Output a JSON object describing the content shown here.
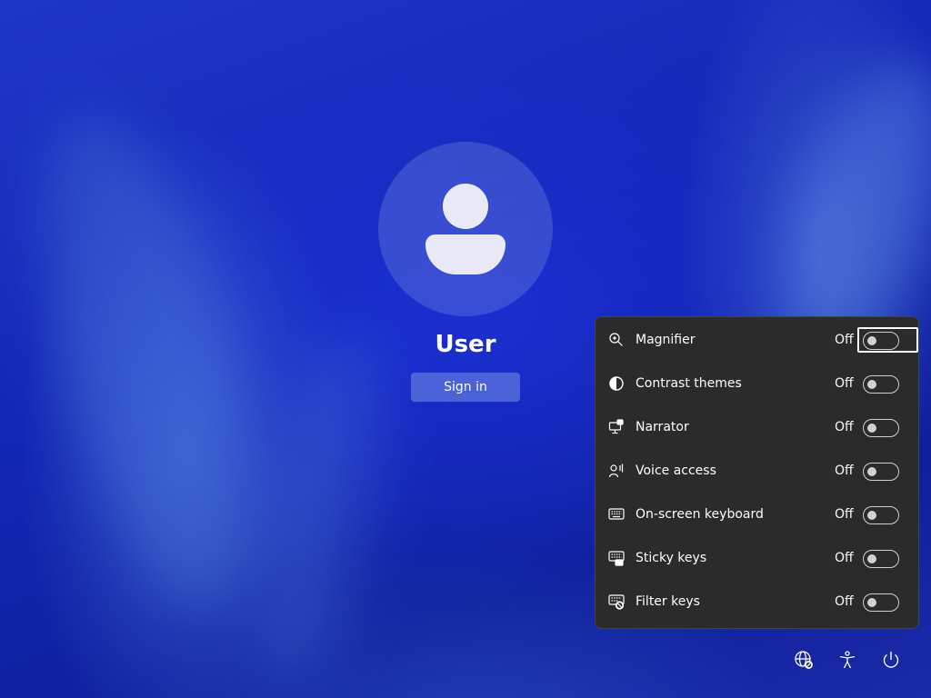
{
  "user": {
    "name": "User",
    "signin_label": "Sign in"
  },
  "accessibility_menu": {
    "items": [
      {
        "label": "Magnifier",
        "state": "Off",
        "icon": "magnifier-icon",
        "focused": true
      },
      {
        "label": "Contrast themes",
        "state": "Off",
        "icon": "contrast-icon"
      },
      {
        "label": "Narrator",
        "state": "Off",
        "icon": "narrator-icon"
      },
      {
        "label": "Voice access",
        "state": "Off",
        "icon": "voice-access-icon"
      },
      {
        "label": "On-screen keyboard",
        "state": "Off",
        "icon": "keyboard-icon"
      },
      {
        "label": "Sticky keys",
        "state": "Off",
        "icon": "sticky-keys-icon"
      },
      {
        "label": "Filter keys",
        "state": "Off",
        "icon": "filter-keys-icon"
      }
    ]
  },
  "bottom_bar": {
    "icons": [
      "network-icon",
      "accessibility-icon",
      "power-icon"
    ]
  },
  "colors": {
    "panel_bg": "#2b2b2b",
    "background": "#1226b4",
    "text": "#ffffff"
  }
}
